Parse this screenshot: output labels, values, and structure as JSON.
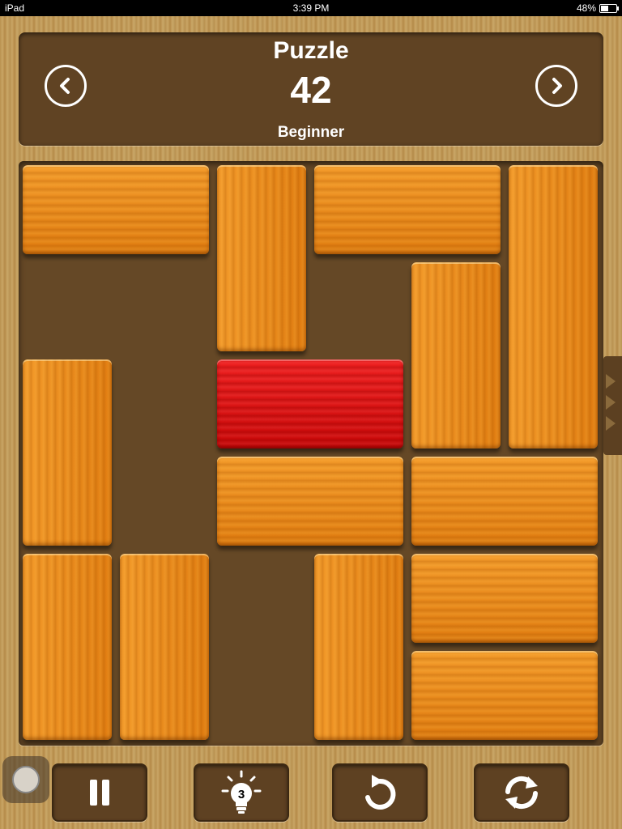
{
  "status_bar": {
    "device": "iPad",
    "time": "3:39 PM",
    "battery": "48%",
    "battery_level": 0.48
  },
  "header": {
    "title": "Puzzle",
    "number": "42",
    "level": "Beginner"
  },
  "toolbar": {
    "hints_remaining": "3"
  },
  "board": {
    "grid_size": 6,
    "target_color": "#e81414",
    "wood_color": "#f0962a",
    "blocks": [
      {
        "id": "b1",
        "col": 0,
        "row": 0,
        "w": 2,
        "h": 1,
        "kind": "h"
      },
      {
        "id": "b2",
        "col": 2,
        "row": 0,
        "w": 1,
        "h": 2,
        "kind": "v"
      },
      {
        "id": "b3",
        "col": 3,
        "row": 0,
        "w": 2,
        "h": 1,
        "kind": "h"
      },
      {
        "id": "b4",
        "col": 5,
        "row": 0,
        "w": 1,
        "h": 3,
        "kind": "v"
      },
      {
        "id": "b5",
        "col": 4,
        "row": 1,
        "w": 1,
        "h": 2,
        "kind": "v"
      },
      {
        "id": "b6",
        "col": 0,
        "row": 2,
        "w": 1,
        "h": 2,
        "kind": "v"
      },
      {
        "id": "target",
        "col": 2,
        "row": 2,
        "w": 2,
        "h": 1,
        "kind": "red"
      },
      {
        "id": "b7",
        "col": 2,
        "row": 3,
        "w": 2,
        "h": 1,
        "kind": "h"
      },
      {
        "id": "b8",
        "col": 4,
        "row": 3,
        "w": 2,
        "h": 1,
        "kind": "h"
      },
      {
        "id": "b9",
        "col": 0,
        "row": 4,
        "w": 1,
        "h": 2,
        "kind": "v"
      },
      {
        "id": "b10",
        "col": 1,
        "row": 4,
        "w": 1,
        "h": 2,
        "kind": "v"
      },
      {
        "id": "b11",
        "col": 3,
        "row": 4,
        "w": 1,
        "h": 2,
        "kind": "v"
      },
      {
        "id": "b12",
        "col": 4,
        "row": 4,
        "w": 2,
        "h": 1,
        "kind": "h"
      },
      {
        "id": "b13",
        "col": 4,
        "row": 5,
        "w": 2,
        "h": 1,
        "kind": "h"
      }
    ]
  }
}
